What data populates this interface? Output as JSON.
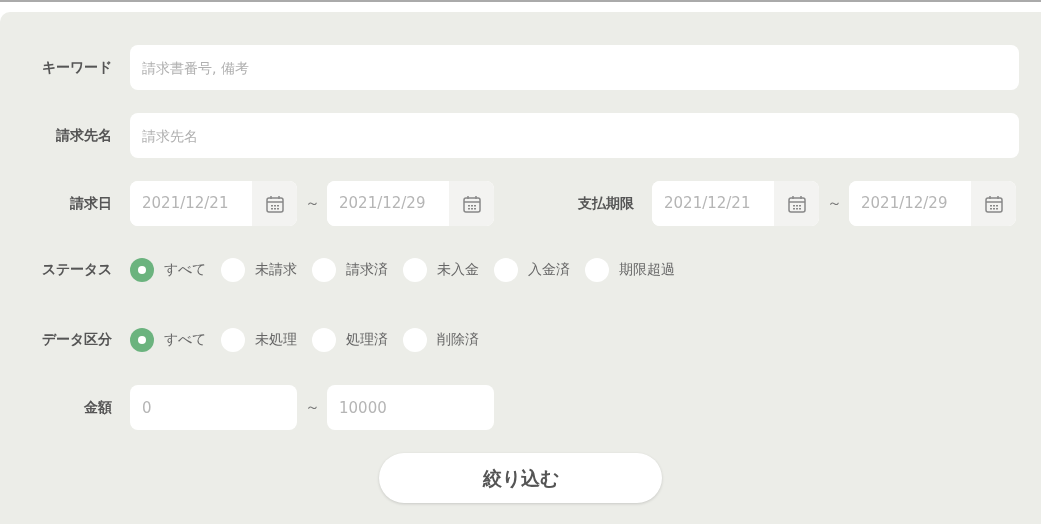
{
  "keyword": {
    "label": "キーワード",
    "placeholder": "請求書番号, 備考"
  },
  "client_name": {
    "label": "請求先名",
    "placeholder": "請求先名"
  },
  "invoice_date": {
    "label": "請求日",
    "from": {
      "placeholder": "2021/12/21"
    },
    "separator": "～",
    "to": {
      "placeholder": "2021/12/29"
    }
  },
  "due_date": {
    "label": "支払期限",
    "from": {
      "placeholder": "2021/12/21"
    },
    "separator": "～",
    "to": {
      "placeholder": "2021/12/29"
    }
  },
  "status": {
    "label": "ステータス",
    "options": [
      {
        "label": "すべて",
        "selected": true
      },
      {
        "label": "未請求",
        "selected": false
      },
      {
        "label": "請求済",
        "selected": false
      },
      {
        "label": "未入金",
        "selected": false
      },
      {
        "label": "入金済",
        "selected": false
      },
      {
        "label": "期限超過",
        "selected": false
      }
    ]
  },
  "data_type": {
    "label": "データ区分",
    "options": [
      {
        "label": "すべて",
        "selected": true
      },
      {
        "label": "未処理",
        "selected": false
      },
      {
        "label": "処理済",
        "selected": false
      },
      {
        "label": "削除済",
        "selected": false
      }
    ]
  },
  "amount": {
    "label": "金額",
    "from": {
      "placeholder": "0"
    },
    "separator": "～",
    "to": {
      "placeholder": "10000"
    }
  },
  "submit_button": "絞り込む"
}
